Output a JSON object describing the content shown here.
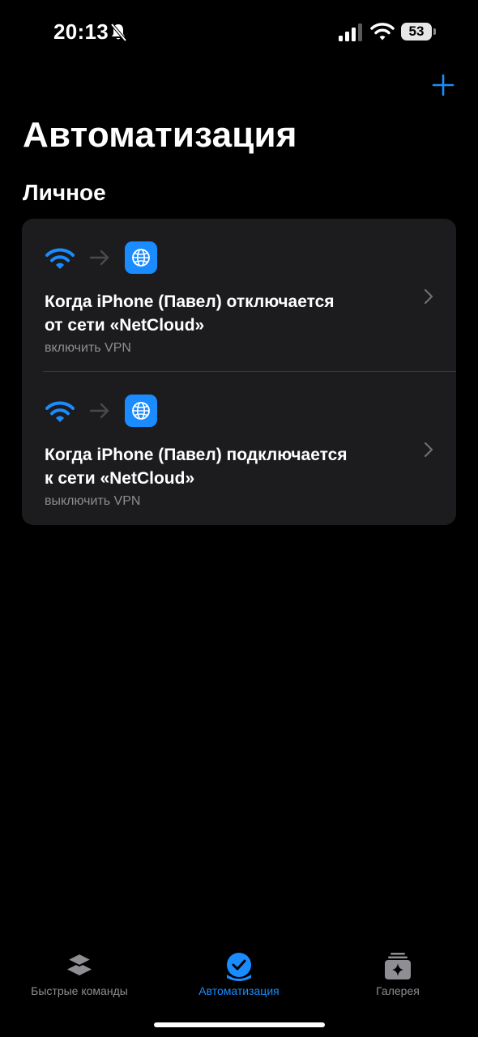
{
  "status_bar": {
    "time": "20:13",
    "battery_percent": "53",
    "icons": [
      "bell-slash-icon",
      "cellular-signal-icon",
      "wifi-icon",
      "battery-icon"
    ]
  },
  "header": {
    "add_icon": "plus-icon",
    "title": "Автоматизация"
  },
  "section": {
    "title": "Личное"
  },
  "automations": [
    {
      "trigger_icon": "wifi-icon",
      "action_icon": "globe-icon",
      "title_line1": "Когда iPhone (Павел) отключается",
      "title_line2": "от сети «NetCloud»",
      "subtitle": "включить VPN"
    },
    {
      "trigger_icon": "wifi-icon",
      "action_icon": "globe-icon",
      "title_line1": "Когда iPhone (Павел) подключается",
      "title_line2": "к сети «NetCloud»",
      "subtitle": "выключить VPN"
    }
  ],
  "tab_bar": {
    "tabs": [
      {
        "label": "Быстрые команды",
        "icon": "layers-icon",
        "active": false
      },
      {
        "label": "Автоматизация",
        "icon": "checkmark-circle-icon",
        "active": true
      },
      {
        "label": "Галерея",
        "icon": "gallery-sparkle-icon",
        "active": false
      }
    ]
  },
  "colors": {
    "accent": "#1a8cff",
    "background": "#000000",
    "card": "#1c1c1e",
    "secondary_text": "#8e8e93"
  }
}
